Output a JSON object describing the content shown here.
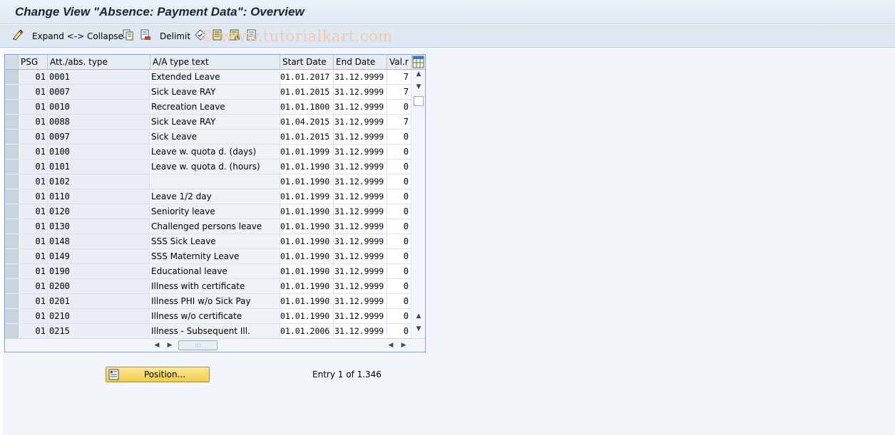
{
  "title": "Change View \"Absence: Payment Data\": Overview",
  "toolbar": {
    "expand_collapse": "Expand <-> Collapse",
    "delimit": "Delimit",
    "watermark": "© www.tutorialkart.com"
  },
  "table": {
    "columns": [
      "PSG",
      "Att./abs. type",
      "A/A type text",
      "Start Date",
      "End Date",
      "Val.r"
    ],
    "rows": [
      {
        "psg": "01",
        "type": "0001",
        "text": "Extended Leave",
        "start": "01.01.2017",
        "end": "31.12.9999",
        "val": "7"
      },
      {
        "psg": "01",
        "type": "0007",
        "text": "Sick Leave RAY",
        "start": "01.01.2015",
        "end": "31.12.9999",
        "val": "7"
      },
      {
        "psg": "01",
        "type": "0010",
        "text": "Recreation Leave",
        "start": "01.01.1800",
        "end": "31.12.9999",
        "val": "0"
      },
      {
        "psg": "01",
        "type": "0088",
        "text": "Sick Leave RAY",
        "start": "01.04.2015",
        "end": "31.12.9999",
        "val": "7"
      },
      {
        "psg": "01",
        "type": "0097",
        "text": "Sick Leave",
        "start": "01.01.2015",
        "end": "31.12.9999",
        "val": "0"
      },
      {
        "psg": "01",
        "type": "0100",
        "text": "Leave w. quota d. (days)",
        "start": "01.01.1999",
        "end": "31.12.9999",
        "val": "0"
      },
      {
        "psg": "01",
        "type": "0101",
        "text": "Leave w. quota d. (hours)",
        "start": "01.01.1990",
        "end": "31.12.9999",
        "val": "0"
      },
      {
        "psg": "01",
        "type": "0102",
        "text": "",
        "start": "01.01.1990",
        "end": "31.12.9999",
        "val": "0"
      },
      {
        "psg": "01",
        "type": "0110",
        "text": "Leave 1/2 day",
        "start": "01.01.1999",
        "end": "31.12.9999",
        "val": "0"
      },
      {
        "psg": "01",
        "type": "0120",
        "text": "Seniority leave",
        "start": "01.01.1990",
        "end": "31.12.9999",
        "val": "0"
      },
      {
        "psg": "01",
        "type": "0130",
        "text": "Challenged persons leave",
        "start": "01.01.1990",
        "end": "31.12.9999",
        "val": "0"
      },
      {
        "psg": "01",
        "type": "0148",
        "text": "SSS Sick Leave",
        "start": "01.01.1990",
        "end": "31.12.9999",
        "val": "0"
      },
      {
        "psg": "01",
        "type": "0149",
        "text": "SSS Maternity Leave",
        "start": "01.01.1990",
        "end": "31.12.9999",
        "val": "0"
      },
      {
        "psg": "01",
        "type": "0190",
        "text": "Educational leave",
        "start": "01.01.1990",
        "end": "31.12.9999",
        "val": "0"
      },
      {
        "psg": "01",
        "type": "0200",
        "text": "Illness with certificate",
        "start": "01.01.1990",
        "end": "31.12.9999",
        "val": "0"
      },
      {
        "psg": "01",
        "type": "0201",
        "text": "Illness PHI w/o Sick Pay",
        "start": "01.01.1990",
        "end": "31.12.9999",
        "val": "0"
      },
      {
        "psg": "01",
        "type": "0210",
        "text": "Illness w/o certificate",
        "start": "01.01.1990",
        "end": "31.12.9999",
        "val": "0"
      },
      {
        "psg": "01",
        "type": "0215",
        "text": "Illness - Subsequent Ill.",
        "start": "01.01.2006",
        "end": "31.12.9999",
        "val": "0"
      }
    ]
  },
  "footer": {
    "position_label": "Position...",
    "entry_text": "Entry 1 of 1.346"
  },
  "icons": {
    "toolbar": [
      "change-display-icon",
      "copy-icon",
      "delete-icon",
      "select-all-icon",
      "select-block-icon",
      "deselect-all-icon",
      "print-icon"
    ],
    "table_settings": "table-settings-icon",
    "position": "position-icon"
  }
}
